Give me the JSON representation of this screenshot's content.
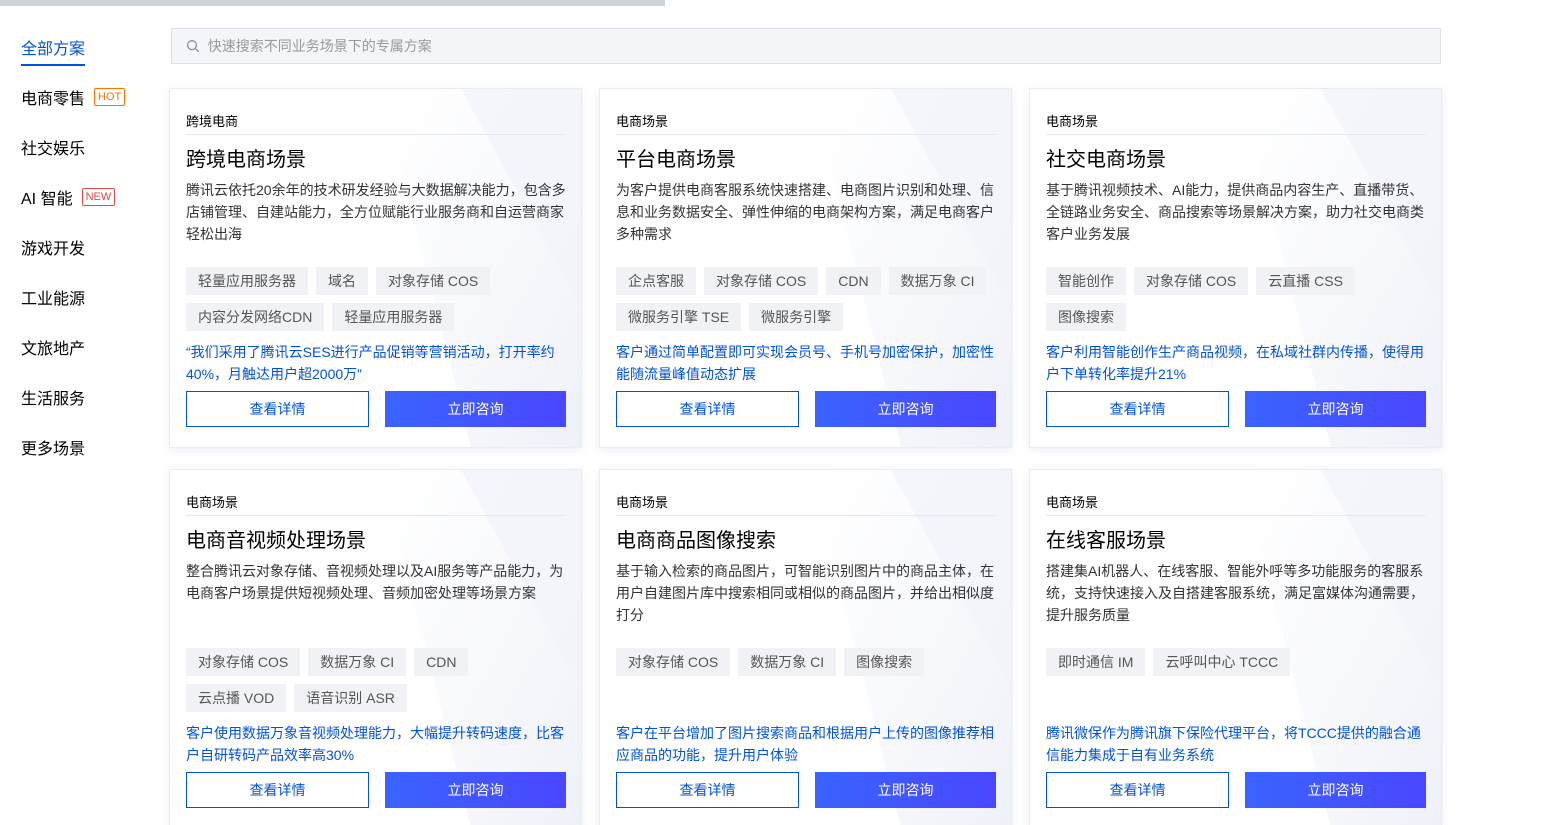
{
  "sidebar": {
    "items": [
      {
        "label": "全部方案",
        "badge": ""
      },
      {
        "label": "电商零售",
        "badge": "HOT"
      },
      {
        "label": "社交娱乐",
        "badge": ""
      },
      {
        "label": "AI 智能",
        "badge": "NEW"
      },
      {
        "label": "游戏开发",
        "badge": ""
      },
      {
        "label": "工业能源",
        "badge": ""
      },
      {
        "label": "文旅地产",
        "badge": ""
      },
      {
        "label": "生活服务",
        "badge": ""
      },
      {
        "label": "更多场景",
        "badge": ""
      }
    ]
  },
  "search": {
    "placeholder": "快速搜索不同业务场景下的专属方案",
    "icon": "search-icon"
  },
  "buttons": {
    "detail": "查看详情",
    "consult": "立即咨询"
  },
  "cards": [
    {
      "category": "跨境电商",
      "title": "跨境电商场景",
      "desc": "腾讯云依托20余年的技术研发经验与大数据解决能力，包含多店铺管理、自建站能力，全方位赋能行业服务商和自运营商家轻松出海",
      "tags": [
        "轻量应用服务器",
        "域名",
        "对象存储 COS",
        "内容分发网络CDN",
        "轻量应用服务器"
      ],
      "case": "“我们采用了腾讯云SES进行产品促销等营销活动，打开率约40%，月触达用户超2000万”"
    },
    {
      "category": "电商场景",
      "title": "平台电商场景",
      "desc": "为客户提供电商客服系统快速搭建、电商图片识别和处理、信息和业务数据安全、弹性伸缩的电商架构方案，满足电商客户多种需求",
      "tags": [
        "企点客服",
        "对象存储 COS",
        "CDN",
        "数据万象 CI",
        "微服务引擎 TSE",
        "微服务引擎"
      ],
      "case": "客户通过简单配置即可实现会员号、手机号加密保护，加密性能随流量峰值动态扩展"
    },
    {
      "category": "电商场景",
      "title": "社交电商场景",
      "desc": "基于腾讯视频技术、AI能力，提供商品内容生产、直播带货、全链路业务安全、商品搜索等场景解决方案，助力社交电商类客户业务发展",
      "tags": [
        "智能创作",
        "对象存储 COS",
        "云直播 CSS",
        "图像搜索"
      ],
      "case": "客户利用智能创作生产商品视频，在私域社群内传播，使得用户下单转化率提升21%"
    },
    {
      "category": "电商场景",
      "title": "电商音视频处理场景",
      "desc": "整合腾讯云对象存储、音视频处理以及AI服务等产品能力，为电商客户场景提供短视频处理、音频加密处理等场景方案",
      "tags": [
        "对象存储 COS",
        "数据万象 CI",
        "CDN",
        "云点播 VOD",
        "语音识别 ASR"
      ],
      "case": "客户使用数据万象音视频处理能力，大幅提升转码速度，比客户自研转码产品效率高30%"
    },
    {
      "category": "电商场景",
      "title": "电商商品图像搜索",
      "desc": "基于输入检索的商品图片，可智能识别图片中的商品主体，在用户自建图片库中搜索相同或相似的商品图片，并给出相似度打分",
      "tags": [
        "对象存储 COS",
        "数据万象 CI",
        "图像搜索"
      ],
      "case": "客户在平台增加了图片搜索商品和根据用户上传的图像推荐相应商品的功能，提升用户体验"
    },
    {
      "category": "电商场景",
      "title": "在线客服场景",
      "desc": "搭建集AI机器人、在线客服、智能外呼等多功能服务的客服系统，支持快速接入及自搭建客服系统，满足富媒体沟通需要，提升服务质量",
      "tags": [
        "即时通信 IM",
        "云呼叫中心 TCCC"
      ],
      "case": "腾讯微保作为腾讯旗下保险代理平台，将TCCC提供的融合通信能力集成于自有业务系统"
    }
  ]
}
